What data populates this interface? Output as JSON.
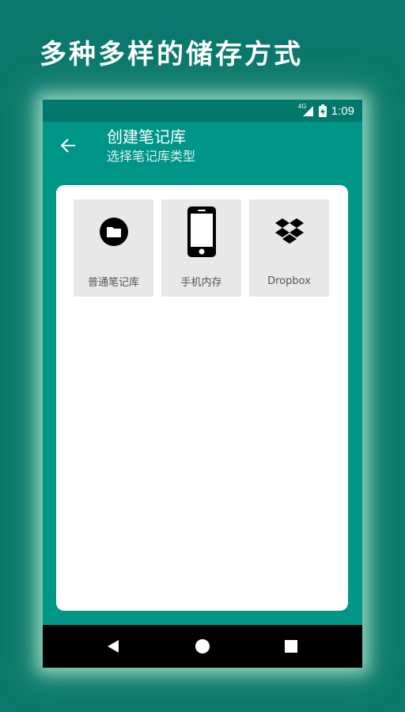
{
  "promo": {
    "title": "多种多样的储存方式"
  },
  "status_bar": {
    "network": "4G",
    "time": "1:09"
  },
  "app_bar": {
    "title": "创建笔记库",
    "subtitle": "选择笔记库类型",
    "back_icon": "arrow-left-icon"
  },
  "storage_options": [
    {
      "label": "普通笔记库",
      "icon": "folder-circle-icon"
    },
    {
      "label": "手机内存",
      "icon": "smartphone-icon"
    },
    {
      "label": "Dropbox",
      "icon": "dropbox-icon"
    }
  ],
  "nav_bar": {
    "back_icon": "triangle-back-icon",
    "home_icon": "circle-home-icon",
    "recents_icon": "square-recents-icon"
  },
  "colors": {
    "background": "#0a786c",
    "primary": "#009687",
    "primary_dark": "#00786b",
    "tile": "#e8e8e8",
    "nav": "#000000"
  }
}
